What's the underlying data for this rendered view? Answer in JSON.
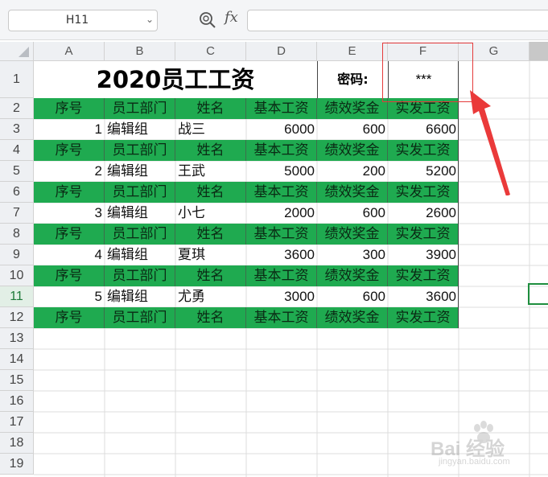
{
  "toolbar": {
    "name_box": "H11",
    "fx_label": "fx",
    "formula_value": ""
  },
  "columns": [
    "A",
    "B",
    "C",
    "D",
    "E",
    "F",
    "G"
  ],
  "rows": [
    "1",
    "2",
    "3",
    "4",
    "5",
    "6",
    "7",
    "8",
    "9",
    "10",
    "11",
    "12",
    "13",
    "14",
    "15",
    "16",
    "17",
    "18",
    "19"
  ],
  "sheet": {
    "title": "2020员工工资",
    "password_label": "密码:",
    "password_value": "***",
    "header": [
      "序号",
      "员工部门",
      "姓名",
      "基本工资",
      "绩效奖金",
      "实发工资"
    ],
    "records": [
      {
        "id": "1",
        "dept": "编辑组",
        "name": "战三",
        "base": "6000",
        "bonus": "600",
        "total": "6600"
      },
      {
        "id": "2",
        "dept": "编辑组",
        "name": "王武",
        "base": "5000",
        "bonus": "200",
        "total": "5200"
      },
      {
        "id": "3",
        "dept": "编辑组",
        "name": "小七",
        "base": "2000",
        "bonus": "600",
        "total": "2600"
      },
      {
        "id": "4",
        "dept": "编辑组",
        "name": "夏琪",
        "base": "3600",
        "bonus": "300",
        "total": "3900"
      },
      {
        "id": "5",
        "dept": "编辑组",
        "name": "尤勇",
        "base": "3000",
        "bonus": "600",
        "total": "3600"
      }
    ]
  },
  "selection": {
    "cell": "H11"
  },
  "watermark": {
    "text": "Bai 经验",
    "sub": "jingyan.baidu.com"
  },
  "colors": {
    "header_green": "#1faa50",
    "annotation_red": "#e53b3b",
    "selection_green": "#1e8e3e"
  }
}
